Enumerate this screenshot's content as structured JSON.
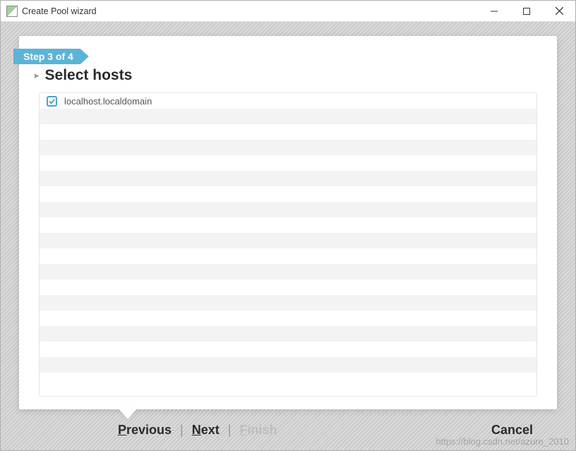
{
  "window": {
    "title": "Create Pool wizard"
  },
  "step": {
    "label": "Step 3 of 4"
  },
  "heading": "Select hosts",
  "hosts": {
    "items": [
      {
        "label": "localhost.localdomain",
        "checked": true
      }
    ],
    "blank_rows": 17
  },
  "nav": {
    "previous": "Previous",
    "next": "Next",
    "finish": "Finish",
    "cancel": "Cancel"
  },
  "watermark": "https://blog.csdn.net/azure_2010"
}
